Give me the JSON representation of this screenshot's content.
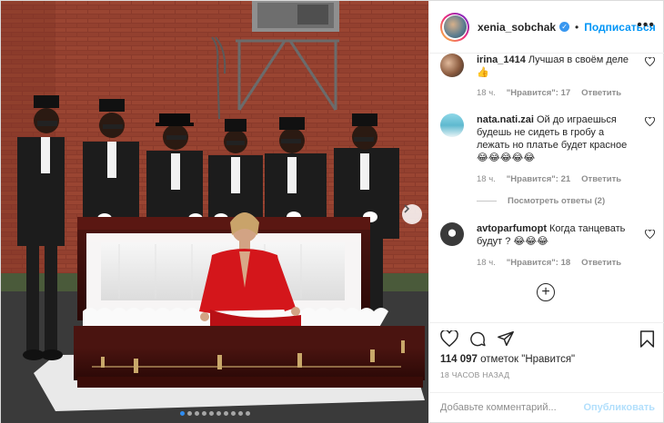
{
  "header": {
    "username": "xenia_sobchak",
    "separator": "•",
    "follow_label": "Подписаться",
    "more_label": "•••"
  },
  "comments": [
    {
      "username": "irina_1414",
      "text": "Лучшая в своём деле 👍",
      "time": "18 ч.",
      "likes": "\"Нравится\": 17",
      "reply": "Ответить"
    },
    {
      "username": "nata.nati.zai",
      "text": "Ой до играешься будешь не сидеть в гробу а лежать но платье будет красное😂😂😂😂😂",
      "time": "18 ч.",
      "likes": "\"Нравится\": 21",
      "reply": "Ответить",
      "view_replies": "Посмотреть ответы (2)"
    },
    {
      "username": "avtoparfumopt",
      "text": "Когда танцевать будут ? 😂😂😂",
      "time": "18 ч.",
      "likes": "\"Нравится\": 18",
      "reply": "Ответить"
    }
  ],
  "post": {
    "likes_count": "114 097",
    "likes_suffix": "отметок \"Нравится\"",
    "time_ago": "18 ЧАСОВ НАЗАД",
    "comment_placeholder": "Добавьте комментарий...",
    "publish_label": "Опубликовать"
  },
  "carousel": {
    "total_slides": 10,
    "active_index": 0
  },
  "colors": {
    "accent": "#0095f6",
    "muted": "#8e8e8e",
    "jacket_red": "#d4161b",
    "brick": "#8c3b2b"
  }
}
